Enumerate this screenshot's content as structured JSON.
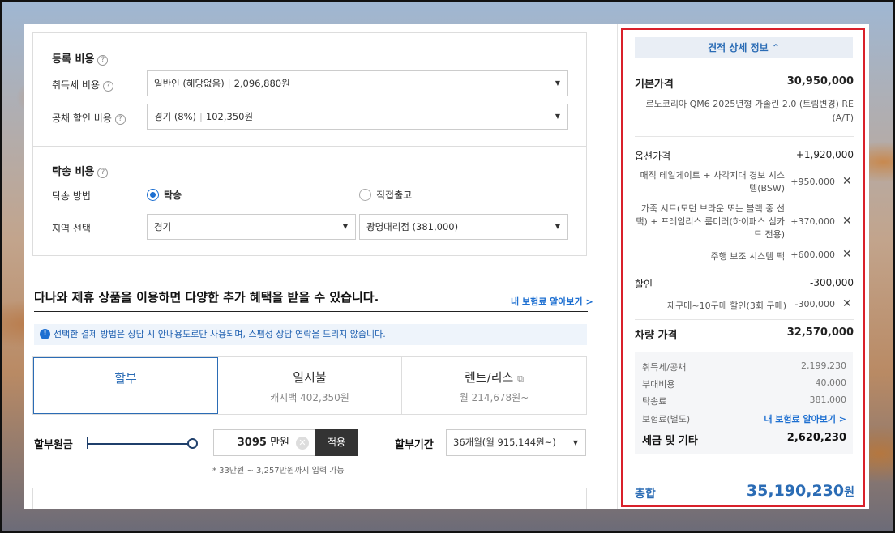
{
  "registration": {
    "title": "등록 비용",
    "acq_tax_label": "취득세 비용",
    "acq_tax_type": "일반인 (해당없음)",
    "acq_tax_value": "2,096,880원",
    "bond_label": "공채 할인 비용",
    "bond_type": "경기 (8%)",
    "bond_value": "102,350원"
  },
  "delivery": {
    "title": "탁송 비용",
    "method_label": "탁송 방법",
    "option_delivery": "탁송",
    "option_direct": "직접출고",
    "region_label": "지역 선택",
    "region_value": "경기",
    "dealer_value": "광명대리점 (381,000)"
  },
  "promo": {
    "text": "다나와 제휴 상품을 이용하면 다양한 추가 혜택을 받을 수 있습니다.",
    "insurance_link": "내 보험료 알아보기 >",
    "notice": "선택한 결제 방법은 상담 시 안내용도로만 사용되며, 스팸성 상담 연락을 드리지 않습니다.",
    "notice_icon": "!"
  },
  "payment_tabs": [
    {
      "title": "할부",
      "sub": ""
    },
    {
      "title": "일시불",
      "sub": "캐시백 402,350원"
    },
    {
      "title": "렌트/리스",
      "sub": "월 214,678원~"
    }
  ],
  "installment": {
    "principal_label": "할부원금",
    "amount": "3095",
    "unit": "만원",
    "apply": "적용",
    "hint": "* 33만원 ~ 3,257만원까지 입력 가능",
    "period_label": "할부기간",
    "period_value": "36개월(월 915,144원~)",
    "slider_level": 1.0
  },
  "quote": {
    "header": "견적 상세 정보",
    "base_label": "기본가격",
    "base_value": "30,950,000",
    "model": "르노코리아 QM6 2025년형 가솔린 2.0 (트림변경) RE (A/T)",
    "option_label": "옵션가격",
    "option_value": "+1,920,000",
    "options": [
      {
        "name": "매직 테일게이트 + 사각지대 경보 시스템(BSW)",
        "price": "+950,000"
      },
      {
        "name": "가죽 시트(모던 브라운 또는 블랙 중 선택) + 프레임리스 룸미러(하이패스 심카드 전용)",
        "price": "+370,000"
      },
      {
        "name": "주행 보조 시스템 팩",
        "price": "+600,000"
      }
    ],
    "discount_label": "할인",
    "discount_value": "-300,000",
    "discount_item": "재구매~10구매 할인(3회 구매)",
    "discount_item_value": "-300,000",
    "vehicle_label": "차량 가격",
    "vehicle_value": "32,570,000",
    "taxes": [
      {
        "name": "취득세/공채",
        "value": "2,199,230"
      },
      {
        "name": "부대비용",
        "value": "40,000"
      },
      {
        "name": "탁송료",
        "value": "381,000"
      }
    ],
    "insurance_label": "보험료(별도)",
    "insurance_link": "내 보험료 알아보기 >",
    "tax_total_label": "세금 및 기타",
    "tax_total_value": "2,620,230",
    "total_label": "총합",
    "total_value": "35,190,230",
    "total_unit": "원"
  }
}
